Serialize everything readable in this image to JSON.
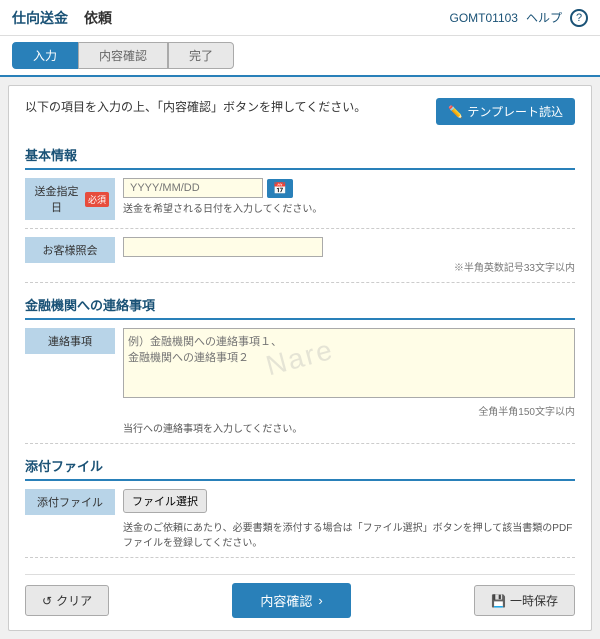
{
  "header": {
    "title1": "仕向送金",
    "title2": "依頼",
    "code": "GOMT01103",
    "help": "ヘルプ"
  },
  "steps": [
    {
      "label": "入力",
      "active": true
    },
    {
      "label": "内容確認",
      "active": false
    },
    {
      "label": "完了",
      "active": false
    }
  ],
  "instruction": "以下の項目を入力の上、「内容確認」ボタンを押してください。",
  "template_btn": "テンプレート読込",
  "sections": {
    "basic_info": {
      "title": "基本情報",
      "fields": [
        {
          "label": "送金指定日",
          "required": true,
          "required_label": "必須",
          "placeholder": "YYYY/MM/DD",
          "hint": "送金を希望される日付を入力してください。"
        },
        {
          "label": "お客様照会",
          "required": false,
          "note": "※半角英数記号33文字以内"
        }
      ]
    },
    "contact": {
      "title": "金融機関への連絡事項",
      "fields": [
        {
          "label": "連絡事項",
          "placeholder": "例）金融機関への連絡事項１、\n金融機関への連絡事項２",
          "note": "全角半角150文字以内",
          "hint": "当行への連絡事項を入力してください。"
        }
      ]
    },
    "attachment": {
      "title": "添付ファイル",
      "fields": [
        {
          "label": "添付ファイル",
          "file_btn": "ファイル選択",
          "hint": "送金のご依頼にあたり、必要書類を添付する場合は「ファイル選択」ボタンを押して該当書類のPDFファイルを登録してください。"
        }
      ]
    }
  },
  "buttons": {
    "clear": "クリア",
    "confirm": "内容確認",
    "save": "一時保存"
  },
  "watermark": "Nare"
}
